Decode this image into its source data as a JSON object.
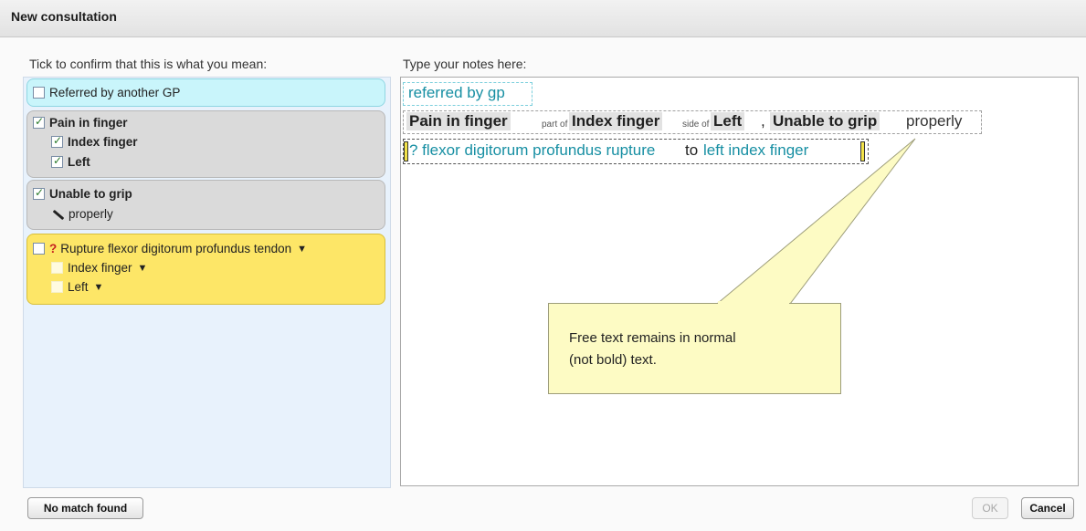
{
  "dialog": {
    "title": "New consultation"
  },
  "left": {
    "label": "Tick to confirm that this is what you mean:",
    "concepts": [
      {
        "label": "Referred by another GP",
        "checked": false
      },
      {
        "label": "Pain in finger",
        "checked": true,
        "children": [
          {
            "label": "Index finger",
            "checked": true
          },
          {
            "label": "Left",
            "checked": true
          }
        ]
      },
      {
        "label": "Unable to grip",
        "checked": true,
        "modifier": "properly",
        "modifier_icon": "pen-icon"
      },
      {
        "prefix": "?",
        "label": "Rupture flexor digitorum profundus tendon",
        "checked": false,
        "arrow": "▼",
        "children": [
          {
            "label": "Index finger",
            "arrow": "▼"
          },
          {
            "label": "Left",
            "arrow": "▼"
          }
        ]
      }
    ]
  },
  "right": {
    "label": "Type your notes here:",
    "line1": {
      "text": "referred by gp"
    },
    "line2": {
      "c1": "Pain in finger",
      "rel1": "part of",
      "c2": "Index finger",
      "rel2": "side of",
      "c3": "Left",
      "sep": ",",
      "c4": "Unable to grip",
      "free": "properly"
    },
    "line3": {
      "t1": "? flexor digitorum profundus rupture",
      "t2": "to",
      "t3": "left index finger"
    }
  },
  "callout": {
    "line1": "Free text remains in normal",
    "line2": "(not bold) text."
  },
  "footer": {
    "no_match": "No match found",
    "ok": "OK",
    "cancel": "Cancel"
  },
  "colors": {
    "accent_cyan": "#c9f5fb",
    "concept_grey": "#dadada",
    "suspected_yellow": "#fde667",
    "teal_text": "#178fa3",
    "callout_bg": "#fdfbc4"
  }
}
